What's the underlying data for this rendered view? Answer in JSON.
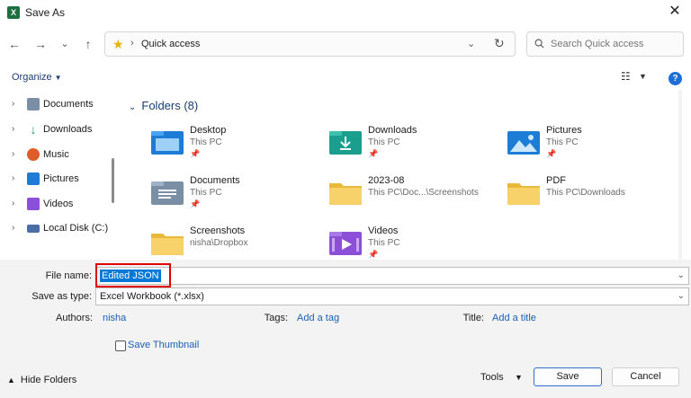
{
  "window": {
    "title": "Save As",
    "app_icon": "excel-icon",
    "close": "✕"
  },
  "nav": {
    "back": "←",
    "forward": "→",
    "recent": "⌄",
    "up": "↑",
    "address": "Quick access",
    "search_placeholder": "Search Quick access"
  },
  "toolbar": {
    "organize": "Organize",
    "help": "?"
  },
  "sidebar": {
    "items": [
      {
        "label": "Documents",
        "icon": "documents-icon",
        "color": "#7a8fa6"
      },
      {
        "label": "Downloads",
        "icon": "downloads-icon",
        "color": "#1a9e6e"
      },
      {
        "label": "Music",
        "icon": "music-icon",
        "color": "#e05c2a"
      },
      {
        "label": "Pictures",
        "icon": "pictures-icon",
        "color": "#1d7dd6"
      },
      {
        "label": "Videos",
        "icon": "videos-icon",
        "color": "#8b4fd8"
      },
      {
        "label": "Local Disk (C:)",
        "icon": "local-disk-icon",
        "color": "#4a6fa5"
      }
    ]
  },
  "content": {
    "header": "Folders (8)",
    "folders": [
      {
        "name": "Desktop",
        "sub": "This PC",
        "pinned": true,
        "icon": "desktop-folder-icon",
        "color": "#1d7dd6"
      },
      {
        "name": "Downloads",
        "sub": "This PC",
        "pinned": true,
        "icon": "downloads-folder-icon",
        "color": "#1a9e8e"
      },
      {
        "name": "Pictures",
        "sub": "This PC",
        "pinned": true,
        "icon": "pictures-folder-icon",
        "color": "#1d7dd6"
      },
      {
        "name": "Documents",
        "sub": "This PC",
        "pinned": true,
        "icon": "documents-folder-icon",
        "color": "#7a8fa6"
      },
      {
        "name": "2023-08",
        "sub": "This PC\\Doc...\\Screenshots",
        "pinned": false,
        "icon": "folder-icon",
        "color": "#f2c44f"
      },
      {
        "name": "PDF",
        "sub": "This PC\\Downloads",
        "pinned": false,
        "icon": "folder-icon",
        "color": "#f2c44f"
      },
      {
        "name": "Screenshots",
        "sub": "nisha\\Dropbox",
        "pinned": false,
        "icon": "folder-icon",
        "color": "#f2c44f"
      },
      {
        "name": "Videos",
        "sub": "This PC",
        "pinned": true,
        "icon": "videos-folder-icon",
        "color": "#8b4fd8"
      }
    ]
  },
  "form": {
    "filename_label": "File name:",
    "filename_value": "Edited JSON",
    "type_label": "Save as type:",
    "type_value": "Excel Workbook (*.xlsx)",
    "authors_label": "Authors:",
    "authors_value": "nisha",
    "tags_label": "Tags:",
    "tags_value": "Add a tag",
    "title_label": "Title:",
    "title_value": "Add a title",
    "thumbnail_label": "Save Thumbnail"
  },
  "footer": {
    "hide_folders": "Hide Folders",
    "tools": "Tools",
    "save": "Save",
    "cancel": "Cancel"
  }
}
